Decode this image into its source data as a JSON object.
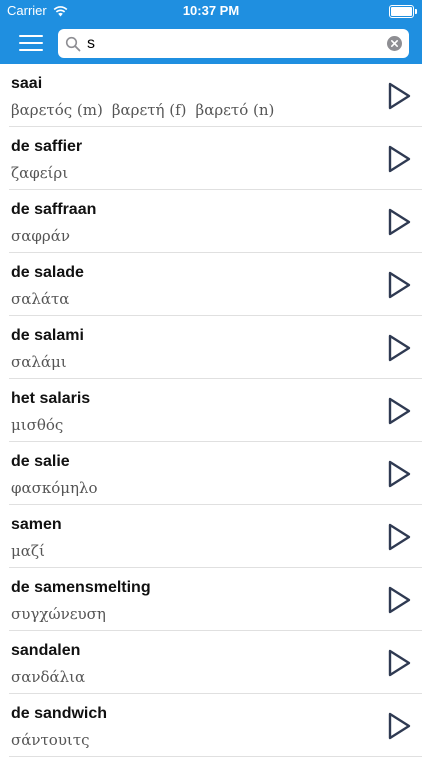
{
  "status_bar": {
    "carrier": "Carrier",
    "time": "10:37 PM"
  },
  "search": {
    "value": "s"
  },
  "entries": [
    {
      "word": "saai",
      "translations": [
        "βαρετός (m)",
        "βαρετή (f)",
        "βαρετό (n)"
      ]
    },
    {
      "word": "de saffier",
      "translations": [
        "ζαφείρι"
      ]
    },
    {
      "word": "de saffraan",
      "translations": [
        "σαφράν"
      ]
    },
    {
      "word": "de salade",
      "translations": [
        "σαλάτα"
      ]
    },
    {
      "word": "de salami",
      "translations": [
        "σαλάμι"
      ]
    },
    {
      "word": "het salaris",
      "translations": [
        "μισθός"
      ]
    },
    {
      "word": "de salie",
      "translations": [
        "φασκόμηλο"
      ]
    },
    {
      "word": "samen",
      "translations": [
        "μαζί"
      ]
    },
    {
      "word": "de samensmelting",
      "translations": [
        "συγχώνευση"
      ]
    },
    {
      "word": "sandalen",
      "translations": [
        "σανδάλια"
      ]
    },
    {
      "word": "de sandwich",
      "translations": [
        "σάντουιτς"
      ]
    }
  ],
  "colors": {
    "accent": "#1f8fe0",
    "play_icon": "#2f3a52"
  }
}
